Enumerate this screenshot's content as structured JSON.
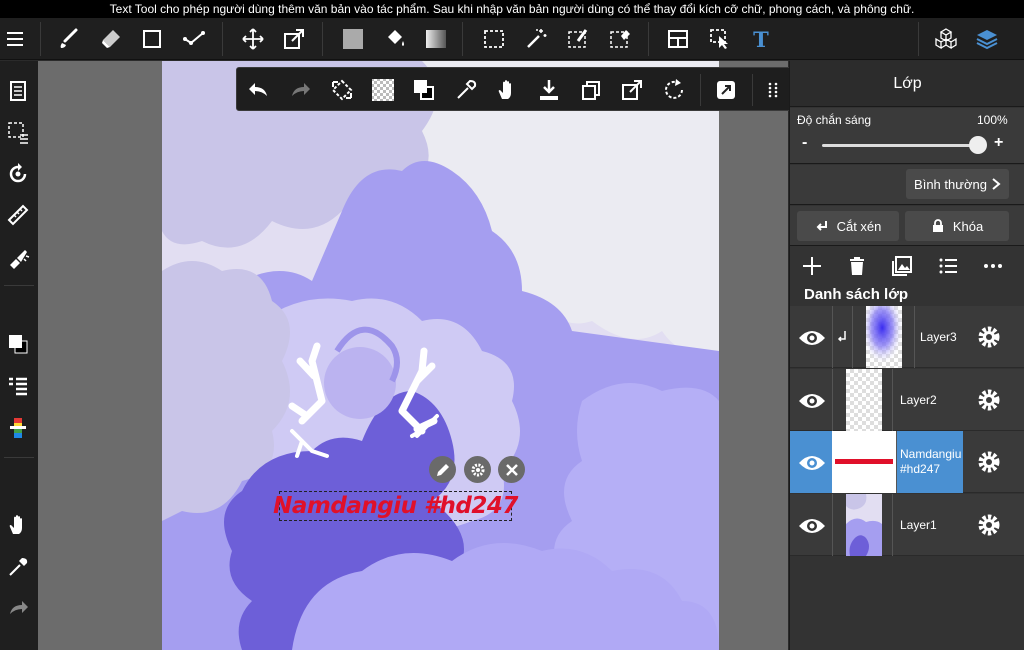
{
  "hint": "Text Tool cho phép người dùng thêm văn bản vào tác phẩm. Sau khi nhập văn bản người dùng có thể thay đổi kích cỡ chữ, phong cách, và phông chữ.",
  "toolbar": {
    "menu_icon": "menu-icon",
    "tools": [
      "brush-icon",
      "eraser-icon",
      "shape-icon",
      "fill-stroke-icon",
      "move-icon",
      "transform-icon",
      "fill-color-icon",
      "bucket-icon",
      "gradient-icon",
      "select-icon",
      "magic-wand-icon",
      "select-pen-icon",
      "select-eraser-icon",
      "frame-icon",
      "operation-icon",
      "text-icon"
    ],
    "right": [
      "3d-icon",
      "layers-icon"
    ]
  },
  "left_toolbar": [
    "layer-list-icon",
    "selection-icon",
    "rotate-view-icon",
    "ruler-icon",
    "filter-icon",
    "color-icon",
    "layer-menu-icon",
    "palette-icon",
    "hand-icon",
    "eyedropper-icon",
    "redo-icon"
  ],
  "float_toolbar": [
    "undo-icon",
    "redo-icon",
    "transform-icon",
    "transparent-icon",
    "color-swap-icon",
    "eyedropper-icon",
    "hand-icon",
    "save-icon",
    "copy-icon",
    "export-icon",
    "rotate-icon",
    "custom-icon",
    "grid-icon"
  ],
  "text_object": {
    "text": "Namdangiu #hd247",
    "controls": [
      "edit-icon",
      "settings-icon",
      "close-icon"
    ]
  },
  "panel": {
    "title": "Lớp",
    "opacity_label": "Độ chắn sáng",
    "opacity_value": "100%",
    "opacity_fraction": 1.0,
    "minus": "-",
    "plus": "+",
    "blend_mode": "Bình thường",
    "clip_label": "Cắt xén",
    "lock_label": "Khóa",
    "list_header": "Danh sách lớp",
    "accent": "#4a90d2",
    "layers": [
      {
        "name": "Layer3",
        "selected": false,
        "clipped": true
      },
      {
        "name": "Layer2",
        "selected": false,
        "clipped": false
      },
      {
        "name": "Namdangiu #hd247",
        "selected": true,
        "clipped": false
      },
      {
        "name": "Layer1",
        "selected": false,
        "clipped": false
      }
    ]
  }
}
